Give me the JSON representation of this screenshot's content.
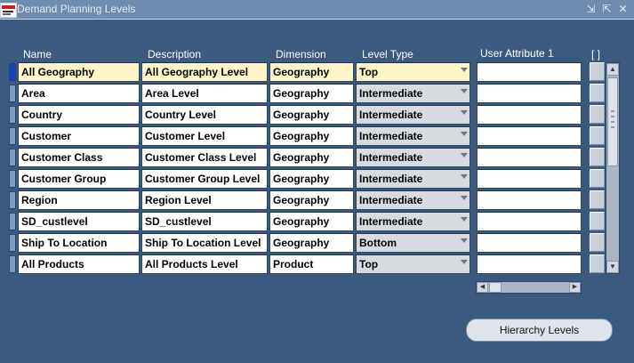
{
  "window": {
    "title": "Demand Planning Levels",
    "icons": [
      "minimize-icon",
      "maximize-icon",
      "close-icon"
    ],
    "icon_glyphs": [
      "⇲",
      "⇱",
      "✕"
    ]
  },
  "columns": {
    "name": "Name",
    "description": "Description",
    "dimension": "Dimension",
    "level_type": "Level Type",
    "user_attribute_1": "User Attribute 1",
    "extra": "[ ]"
  },
  "rows": [
    {
      "name": "All Geography",
      "description": "All Geography Level",
      "dimension": "Geography",
      "level_type": "Top",
      "active": true
    },
    {
      "name": "Area",
      "description": "Area Level",
      "dimension": "Geography",
      "level_type": "Intermediate"
    },
    {
      "name": "Country",
      "description": "Country Level",
      "dimension": "Geography",
      "level_type": "Intermediate"
    },
    {
      "name": "Customer",
      "description": "Customer Level",
      "dimension": "Geography",
      "level_type": "Intermediate"
    },
    {
      "name": "Customer Class",
      "description": "Customer Class Level",
      "dimension": "Geography",
      "level_type": "Intermediate"
    },
    {
      "name": "Customer Group",
      "description": "Customer Group Level",
      "dimension": "Geography",
      "level_type": "Intermediate"
    },
    {
      "name": "Region",
      "description": "Region Level",
      "dimension": "Geography",
      "level_type": "Intermediate"
    },
    {
      "name": "SD_custlevel",
      "description": "SD_custlevel",
      "dimension": "Geography",
      "level_type": "Intermediate"
    },
    {
      "name": "Ship To Location",
      "description": "Ship To Location Level",
      "dimension": "Geography",
      "level_type": "Bottom"
    },
    {
      "name": "All Products",
      "description": "All Products Level",
      "dimension": "Product",
      "level_type": "Top"
    }
  ],
  "buttons": {
    "hierarchy_levels": "Hierarchy Levels"
  },
  "colors": {
    "background": "#3b5a80",
    "titlebar": "#6d8cb0",
    "current_record": "#fff5c8",
    "row_indicator_active": "#1740c9"
  }
}
